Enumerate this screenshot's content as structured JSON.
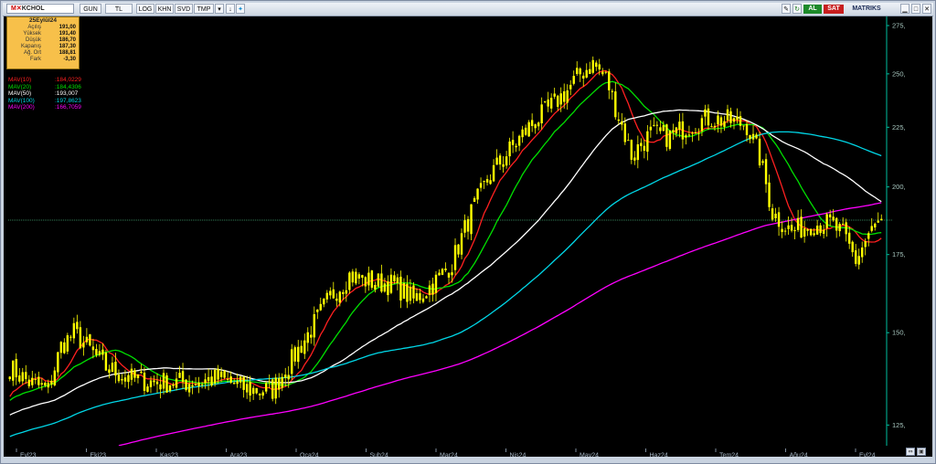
{
  "toolbar": {
    "symbol": "KCHOL",
    "buttons": [
      "GUN",
      "TL",
      "LOG",
      "KHN",
      "SVD",
      "TMP"
    ],
    "window_controls": [
      "AL",
      "SAT"
    ],
    "brand": "MATRIKS"
  },
  "infobox": {
    "date": "25Eylül24",
    "rows": [
      {
        "label": "Açılış",
        "value": "191,00"
      },
      {
        "label": "Yüksek",
        "value": "191,40"
      },
      {
        "label": "Düşük",
        "value": "186,70"
      },
      {
        "label": "Kapanış",
        "value": "187,30"
      },
      {
        "label": "Ağ. Ort",
        "value": "188,81"
      },
      {
        "label": "Fark",
        "value": "-3,30"
      }
    ]
  },
  "legend": [
    {
      "name": "MAV(10)",
      "value": ":184,0229",
      "color": "#ff2020"
    },
    {
      "name": "MAV(20)",
      "value": ":184,4306",
      "color": "#00e000"
    },
    {
      "name": "MAV(50)",
      "value": ":193,007",
      "color": "#ffffff"
    },
    {
      "name": "MAV(100)",
      "value": ":197,8623",
      "color": "#00d6e6"
    },
    {
      "name": "MAV(200)",
      "value": ":166,7059",
      "color": "#ff00ff"
    }
  ],
  "chart_data": {
    "type": "candlestick",
    "x_tick_labels": [
      "Eyl23",
      "Eki23",
      "Kas23",
      "Ara23",
      "Oca24",
      "Şub24",
      "Mar24",
      "Nis24",
      "May24",
      "Haz24",
      "Tem24",
      "Ağu24",
      "Eyl24"
    ],
    "y_ticks": [
      125,
      150,
      175,
      200,
      225,
      250,
      275
    ],
    "y_tick_labels": [
      "125,",
      "150,",
      "175,",
      "200,",
      "225,",
      "250,",
      "275,"
    ],
    "ylim": [
      120,
      280
    ],
    "y_scale": "log",
    "last_close": 187.3,
    "close_anchors": [
      [
        0,
        140
      ],
      [
        6,
        136
      ],
      [
        12,
        134
      ],
      [
        16,
        146
      ],
      [
        20,
        150
      ],
      [
        25,
        145
      ],
      [
        30,
        140
      ],
      [
        38,
        137
      ],
      [
        45,
        136
      ],
      [
        55,
        136
      ],
      [
        65,
        137
      ],
      [
        75,
        134
      ],
      [
        82,
        134
      ],
      [
        88,
        142
      ],
      [
        94,
        151
      ],
      [
        100,
        161
      ],
      [
        106,
        168
      ],
      [
        112,
        166
      ],
      [
        120,
        165
      ],
      [
        126,
        160
      ],
      [
        132,
        165
      ],
      [
        138,
        172
      ],
      [
        144,
        190
      ],
      [
        150,
        205
      ],
      [
        156,
        215
      ],
      [
        162,
        225
      ],
      [
        168,
        233
      ],
      [
        174,
        242
      ],
      [
        178,
        250
      ],
      [
        182,
        255
      ],
      [
        186,
        248
      ],
      [
        190,
        230
      ],
      [
        194,
        213
      ],
      [
        200,
        222
      ],
      [
        206,
        221
      ],
      [
        212,
        226
      ],
      [
        218,
        229
      ],
      [
        224,
        228
      ],
      [
        230,
        226
      ],
      [
        234,
        212
      ],
      [
        238,
        190
      ],
      [
        244,
        183
      ],
      [
        250,
        186
      ],
      [
        256,
        186
      ],
      [
        260,
        182
      ],
      [
        264,
        173
      ],
      [
        268,
        182
      ],
      [
        272,
        187.3
      ]
    ],
    "series": [
      {
        "name": "MAV(10)",
        "color": "#ff2020",
        "period": 10
      },
      {
        "name": "MAV(20)",
        "color": "#00e000",
        "period": 20
      },
      {
        "name": "MAV(50)",
        "color": "#ffffff",
        "period": 50
      },
      {
        "name": "MAV(100)",
        "color": "#00d6e6",
        "period": 100
      },
      {
        "name": "MAV(200)",
        "color": "#ff00ff",
        "period": 200
      }
    ],
    "candle_color": "#ffff00",
    "axis_color": "#00c0a0",
    "grid": false
  }
}
